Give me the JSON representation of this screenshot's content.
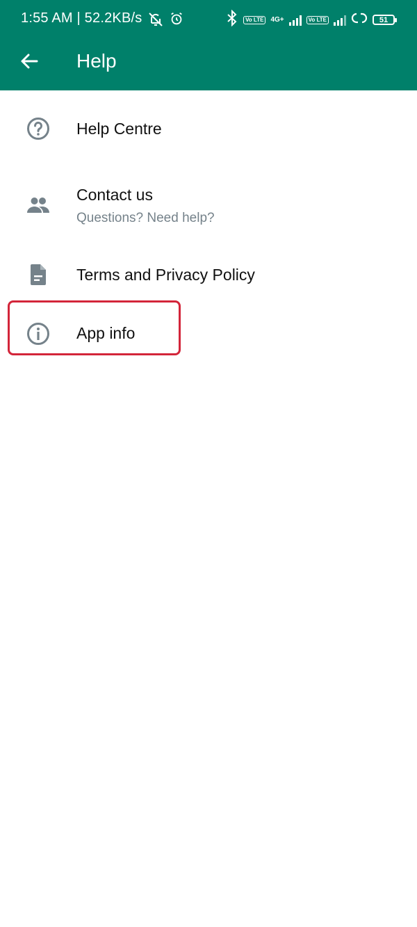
{
  "status_bar": {
    "text": "1:55 AM | 52.2KB/s",
    "sim1_badge": "Vo LTE",
    "network_type": "4G+",
    "sim2_badge": "Vo LTE",
    "battery_level": "51",
    "icons": [
      "bell-off-icon",
      "alarm-icon",
      "bluetooth-icon",
      "signal-icon",
      "hotspot-icon",
      "battery-icon"
    ]
  },
  "app_bar": {
    "title": "Help",
    "color": "#00806a",
    "back_icon": "arrow-back-icon"
  },
  "menu": {
    "items": [
      {
        "label": "Help Centre",
        "icon": "help-circle-icon"
      },
      {
        "label": "Contact us",
        "subtitle": "Questions? Need help?",
        "icon": "people-icon"
      },
      {
        "label": "Terms and Privacy Policy",
        "icon": "document-icon"
      },
      {
        "label": "App info",
        "icon": "info-icon"
      }
    ]
  },
  "highlight": {
    "target": "App info",
    "color": "#d3253a"
  }
}
